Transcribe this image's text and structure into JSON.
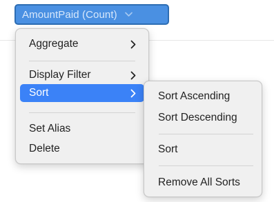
{
  "field_pill": {
    "label": "AmountPaid (Count)",
    "chevron_icon": "chevron-down-icon"
  },
  "context_menu": {
    "items": [
      {
        "label": "Aggregate",
        "has_submenu": true
      },
      {
        "label": "Display Filter",
        "has_submenu": true
      },
      {
        "label": "Sort",
        "has_submenu": true,
        "selected": true
      },
      {
        "label": "Set Alias",
        "has_submenu": false
      },
      {
        "label": "Delete",
        "has_submenu": false
      }
    ],
    "submenu_arrow_icon": "chevron-right-icon"
  },
  "sort_submenu": {
    "items": [
      {
        "label": "Sort Ascending"
      },
      {
        "label": "Sort Descending"
      },
      {
        "label": "Sort"
      },
      {
        "label": "Remove All Sorts"
      }
    ]
  },
  "colors": {
    "pill_background": "#4a90e2",
    "pill_text": "#d8e8fb",
    "selection": "#3b82f7",
    "menu_background": "#f0f0f0"
  }
}
